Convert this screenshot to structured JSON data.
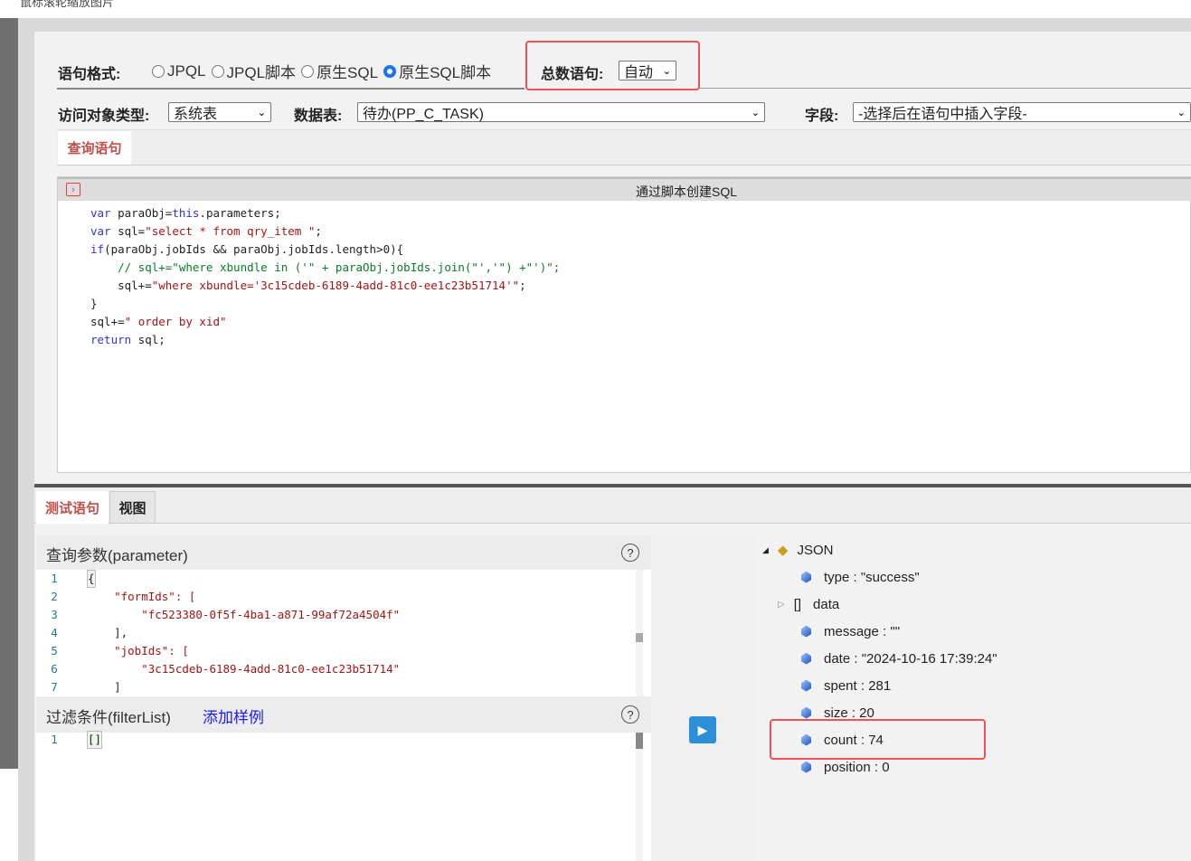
{
  "caption": "鼠标滚轮缩放图片",
  "format": {
    "label": "语句格式:",
    "options": [
      "JPQL",
      "JPQL脚本",
      "原生SQL",
      "原生SQL脚本"
    ],
    "selected": "原生SQL脚本"
  },
  "count_stmt": {
    "label": "总数语句:",
    "value": "自动"
  },
  "access": {
    "label": "访问对象类型:",
    "value": "系统表"
  },
  "table": {
    "label": "数据表:",
    "value": "待办(PP_C_TASK)"
  },
  "field": {
    "label": "字段:",
    "value": "-选择后在语句中插入字段-"
  },
  "query_tab": "查询语句",
  "editor_title": "通过脚本创建SQL",
  "code_lines": [
    "var paraObj=this.parameters;",
    "var sql=\"select * from qry_item \";",
    "if(paraObj.jobIds && paraObj.jobIds.length>0){",
    "    // sql+=\"where xbundle in ('\" + paraObj.jobIds.join(\"','\") +\"')\";",
    "    sql+=\"where xbundle='3c15cdeb-6189-4add-81c0-ee1c23b51714'\";",
    "}",
    "sql+=\" order by xid\"",
    "return sql;"
  ],
  "bottom_tabs": [
    "测试语句",
    "视图"
  ],
  "param": {
    "title": "查询参数(parameter)",
    "help": "?",
    "lines": [
      "{",
      "    \"formIds\": [",
      "        \"fc523380-0f5f-4ba1-a871-99af72a4504f\"",
      "    ],",
      "    \"jobIds\": [",
      "        \"3c15cdeb-6189-4add-81c0-ee1c23b51714\"",
      "    ]"
    ],
    "line_numbers": [
      "1",
      "2",
      "3",
      "4",
      "5",
      "6",
      "7"
    ]
  },
  "filter": {
    "title": "过滤条件(filterList)",
    "add_sample": "添加样例",
    "help": "?",
    "lines": [
      "[]"
    ],
    "line_numbers": [
      "1"
    ]
  },
  "result": {
    "root": "JSON",
    "items": [
      {
        "text": "type : \"success\"",
        "kind": "value"
      },
      {
        "text": "data",
        "kind": "array",
        "icon": "[]"
      },
      {
        "text": "message : \"\"",
        "kind": "value"
      },
      {
        "text": "date : \"2024-10-16 17:39:24\"",
        "kind": "value"
      },
      {
        "text": "spent : 281",
        "kind": "value"
      },
      {
        "text": "size : 20",
        "kind": "value"
      },
      {
        "text": "count : 74",
        "kind": "value"
      },
      {
        "text": "position : 0",
        "kind": "value"
      }
    ]
  },
  "colors": {
    "highlight": "#f0505a",
    "run": "#2d8fd8",
    "tab_active": "#c0504d"
  }
}
